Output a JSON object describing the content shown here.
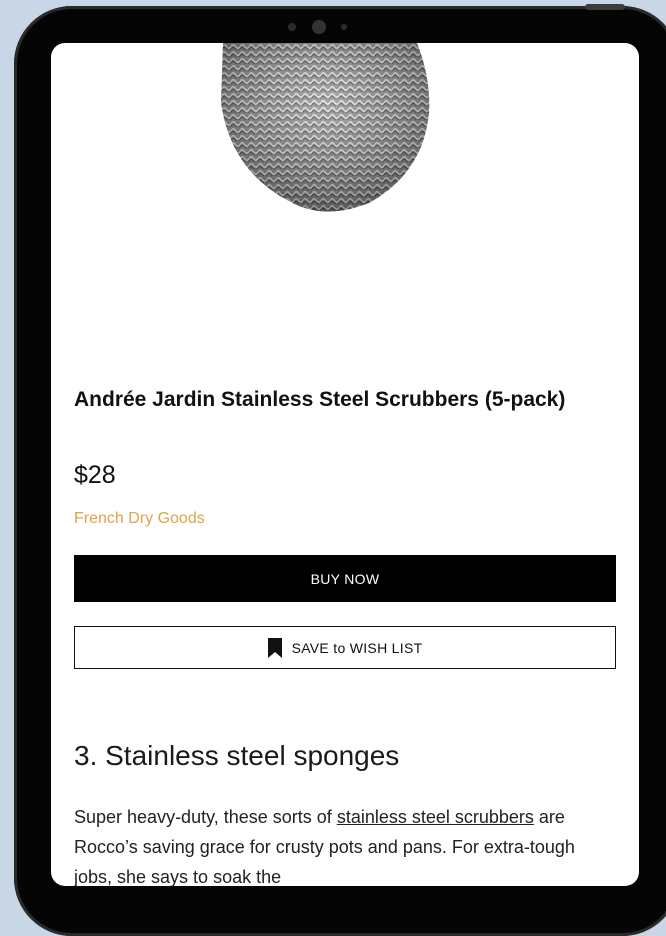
{
  "product": {
    "title": "Andrée Jardin Stainless Steel Scrubbers (5-pack)",
    "price": "$28",
    "brand": "French Dry Goods",
    "image_icon": "steel-scrubber-image"
  },
  "actions": {
    "buy_label": "BUY NOW",
    "wishlist_label": "SAVE to WISH LIST",
    "wishlist_icon": "bookmark-icon"
  },
  "article": {
    "heading": "3. Stainless steel sponges",
    "body_part1": "Super heavy-duty, these sorts of ",
    "body_link": "stainless steel scrubbers",
    "body_part2": " are Rocco’s saving grace for crusty pots and pans. For extra-tough jobs, she says to soak the"
  },
  "colors": {
    "brand_link": "#e0a24a",
    "primary_button": "#000000",
    "background": "#c9d6e6"
  }
}
